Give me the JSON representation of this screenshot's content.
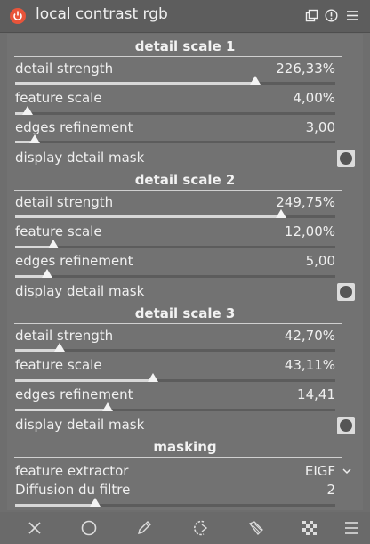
{
  "module": {
    "title": "local contrast rgb",
    "accent": "#e8543a"
  },
  "sections": [
    {
      "title": "detail scale 1",
      "detail_strength": {
        "label": "detail strength",
        "value": "226,33%",
        "fraction": 0.75
      },
      "feature_scale": {
        "label": "feature scale",
        "value": "4,00%",
        "fraction": 0.04
      },
      "edges_refinement": {
        "label": "edges refinement",
        "value": "3,00",
        "fraction": 0.06
      },
      "display_mask": {
        "label": "display detail mask"
      }
    },
    {
      "title": "detail scale 2",
      "detail_strength": {
        "label": "detail strength",
        "value": "249,75%",
        "fraction": 0.83
      },
      "feature_scale": {
        "label": "feature scale",
        "value": "12,00%",
        "fraction": 0.12
      },
      "edges_refinement": {
        "label": "edges refinement",
        "value": "5,00",
        "fraction": 0.1
      },
      "display_mask": {
        "label": "display detail mask"
      }
    },
    {
      "title": "detail scale 3",
      "detail_strength": {
        "label": "detail strength",
        "value": "42,70%",
        "fraction": 0.14
      },
      "feature_scale": {
        "label": "feature scale",
        "value": "43,11%",
        "fraction": 0.43
      },
      "edges_refinement": {
        "label": "edges refinement",
        "value": "14,41",
        "fraction": 0.29
      },
      "display_mask": {
        "label": "display detail mask"
      }
    }
  ],
  "masking": {
    "title": "masking",
    "feature_extractor": {
      "label": "feature extractor",
      "value": "EIGF"
    },
    "diffusion": {
      "label": "Diffusion du filtre",
      "value": "2",
      "fraction": 0.25
    }
  },
  "footer": {
    "icons": [
      "close-icon",
      "circle-icon",
      "pencil-icon",
      "drawn-parametric-icon",
      "parametric-icon",
      "raster-icon",
      "menu-icon"
    ]
  }
}
